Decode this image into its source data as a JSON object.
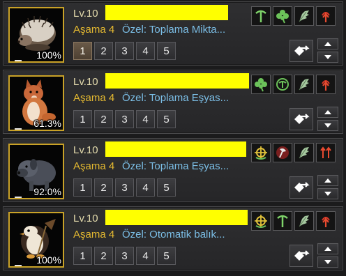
{
  "pets": [
    {
      "level": "Lv.10",
      "tier": "Aşama 4",
      "special_skill": "Özel: Toplama Mikta...",
      "hunger": "100%",
      "animal": "hedgehog-icon",
      "skills": [
        "pickaxe-icon",
        "clover-icon",
        "wing-icon",
        "red-arrow-up-icon"
      ],
      "tabs": [
        "1",
        "2",
        "3",
        "4",
        "5"
      ],
      "active_tab": "1"
    },
    {
      "level": "Lv.10",
      "tier": "Aşama 4",
      "special_skill": "Özel: Toplama Eşyas...",
      "hunger": "61.3%",
      "animal": "fox-icon",
      "skills": [
        "clover-icon",
        "circle-pickaxe-icon",
        "wing-icon",
        "red-arrow-up-icon"
      ],
      "tabs": [
        "1",
        "2",
        "3",
        "4",
        "5"
      ],
      "active_tab": ""
    },
    {
      "level": "Lv.10",
      "tier": "Aşama 4",
      "special_skill": "Özel: Toplama Eşyas...",
      "hunger": "92.0%",
      "animal": "dog-icon",
      "skills": [
        "crosshair-icon",
        "red-axe-icon",
        "wing-icon",
        "double-red-arrow-icon"
      ],
      "tabs": [
        "1",
        "2",
        "3",
        "4",
        "5"
      ],
      "active_tab": ""
    },
    {
      "level": "Lv.10",
      "tier": "Aşama 4",
      "special_skill": "Özel: Otomatik balık...",
      "hunger": "100%",
      "animal": "penguin-icon",
      "skills": [
        "crosshair-icon",
        "pickaxe-icon",
        "wing-icon",
        "red-arrow-up-icon"
      ],
      "tabs": [
        "1",
        "2",
        "3",
        "4",
        "5"
      ],
      "active_tab": ""
    }
  ],
  "colors": {
    "level": "#e5dcae",
    "tier": "#e4b931",
    "skill": "#7bbee6",
    "portrait_border": "#c9a227",
    "name_redaction": "#ffff00"
  }
}
